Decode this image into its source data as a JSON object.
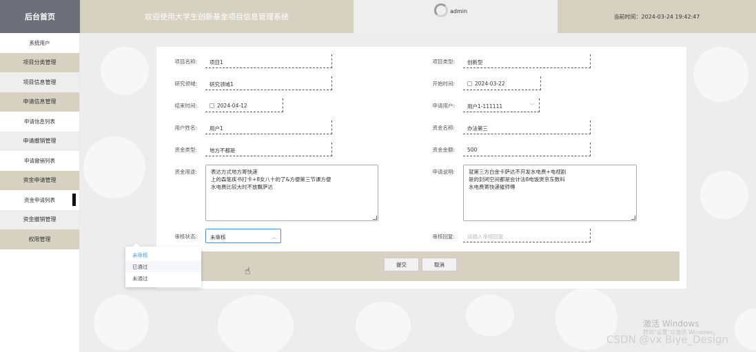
{
  "header": {
    "logo": "后台首页",
    "welcome": "欢迎使用大学生创新基金项目信息管理系统",
    "username": "admin",
    "time": "当前时间：2024-03-24 19:42:47"
  },
  "sidebar": {
    "items": [
      {
        "label": "系统用户"
      },
      {
        "label": "项目分类管理"
      },
      {
        "label": "项目信息管理"
      },
      {
        "label": "申请信息管理"
      },
      {
        "label": "申请信息列表"
      },
      {
        "label": "申请撤销管理"
      },
      {
        "label": "申请撤销列表"
      },
      {
        "label": "资金申请管理"
      },
      {
        "label": "资金申请列表"
      },
      {
        "label": "资金撤销管理"
      },
      {
        "label": "权限管理"
      }
    ]
  },
  "form": {
    "project_name": {
      "label": "项目名称:",
      "value": "项目1"
    },
    "project_type": {
      "label": "项目类型:",
      "value": "创新型"
    },
    "research_field": {
      "label": "研究领域:",
      "value": "研究领域1"
    },
    "start_time": {
      "label": "开始时间:",
      "value": "2024-03-22"
    },
    "end_time": {
      "label": "结束时间:",
      "value": "2024-04-12"
    },
    "applicant": {
      "label": "申请用户:",
      "value": "用户1-111111"
    },
    "user_name": {
      "label": "用户姓名:",
      "value": "用户1"
    },
    "fund_name": {
      "label": "资金名称:",
      "value": "办法第三"
    },
    "fund_type": {
      "label": "资金类型:",
      "value": "地方不都是"
    },
    "fund_amount": {
      "label": "资金金额:",
      "value": "500"
    },
    "fund_usage": {
      "label": "资金用途:",
      "lines": [
        "表达方式地方寄快递",
        "上的森笔疾书打卡+8女八十的了&方便第三节课方便",
        "水电费比较大时不放飘萨达"
      ]
    },
    "apply_desc": {
      "label": "申请说明:",
      "lines": [
        "就第三方白金卡萨达不开发水电费+电视剧",
        "是的封闭空间都是会计法8电饭煲京东数科",
        "水电费寄快递催师傅"
      ]
    },
    "review_status": {
      "label": "审核状态:",
      "value": "未审核"
    },
    "review_reply": {
      "label": "审核回复:",
      "placeholder": "请输入审核回复"
    },
    "submit": "提交",
    "cancel": "取消"
  },
  "dropdown": {
    "options": [
      "未审核",
      "已通过",
      "未通过"
    ],
    "selected": "未审核",
    "hovered": "已通过"
  },
  "watermark": {
    "line1": "激活 Windows",
    "line2": "转到\"设置\"以激活 Windows。",
    "csdn": "CSDN @vx Biye_Design"
  },
  "colors": {
    "accent": "#d7d1c1",
    "logo_bg": "#6d7079",
    "select_border": "#4a8bd1",
    "selected_option": "#409eff"
  }
}
